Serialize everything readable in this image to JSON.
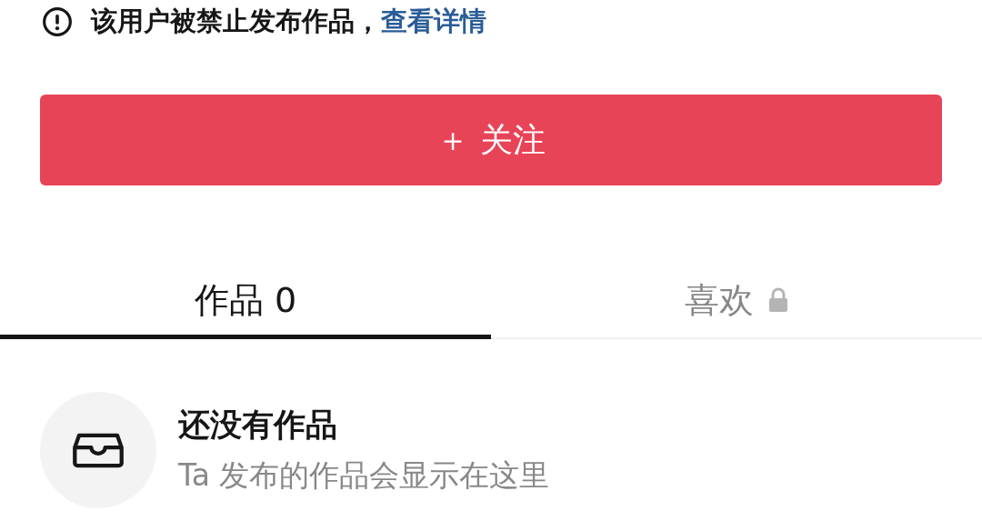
{
  "notice": {
    "text": "该用户被禁止发布作品，",
    "link": "查看详情"
  },
  "follow_button": {
    "label": "＋ 关注"
  },
  "tabs": [
    {
      "label": "作品 0",
      "selected": true,
      "locked": false
    },
    {
      "label": "喜欢",
      "selected": false,
      "locked": true
    }
  ],
  "empty_state": {
    "title": "还没有作品",
    "subtitle": "Ta 发布的作品会显示在这里"
  }
}
